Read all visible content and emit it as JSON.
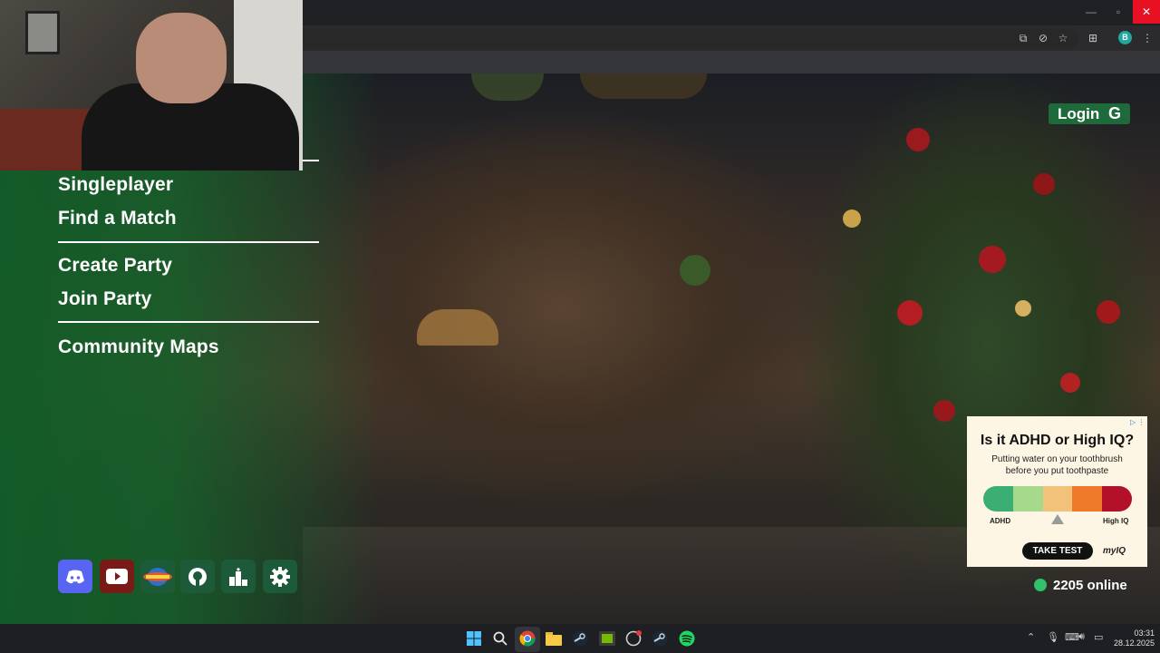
{
  "menu": {
    "items": [
      "Singleplayer",
      "Find a Match",
      "Create Party",
      "Join Party",
      "Community Maps"
    ]
  },
  "header": {
    "login_label": "Login",
    "login_icon": "G"
  },
  "ad": {
    "info_icon": "▷ ⋮",
    "title": "Is it ADHD or High IQ?",
    "subtitle": "Putting water on your toothbrush before you put toothpaste",
    "scale_left": "ADHD",
    "scale_right": "High IQ",
    "button": "TAKE TEST",
    "brand": "myIQ",
    "scale_colors": [
      "#3aae73",
      "#a6d98c",
      "#f2c27a",
      "#ee7a2a",
      "#b3102a"
    ]
  },
  "status": {
    "online_text": "2205 online"
  },
  "clock": {
    "time": "03:31",
    "date": "28.12.2025"
  }
}
